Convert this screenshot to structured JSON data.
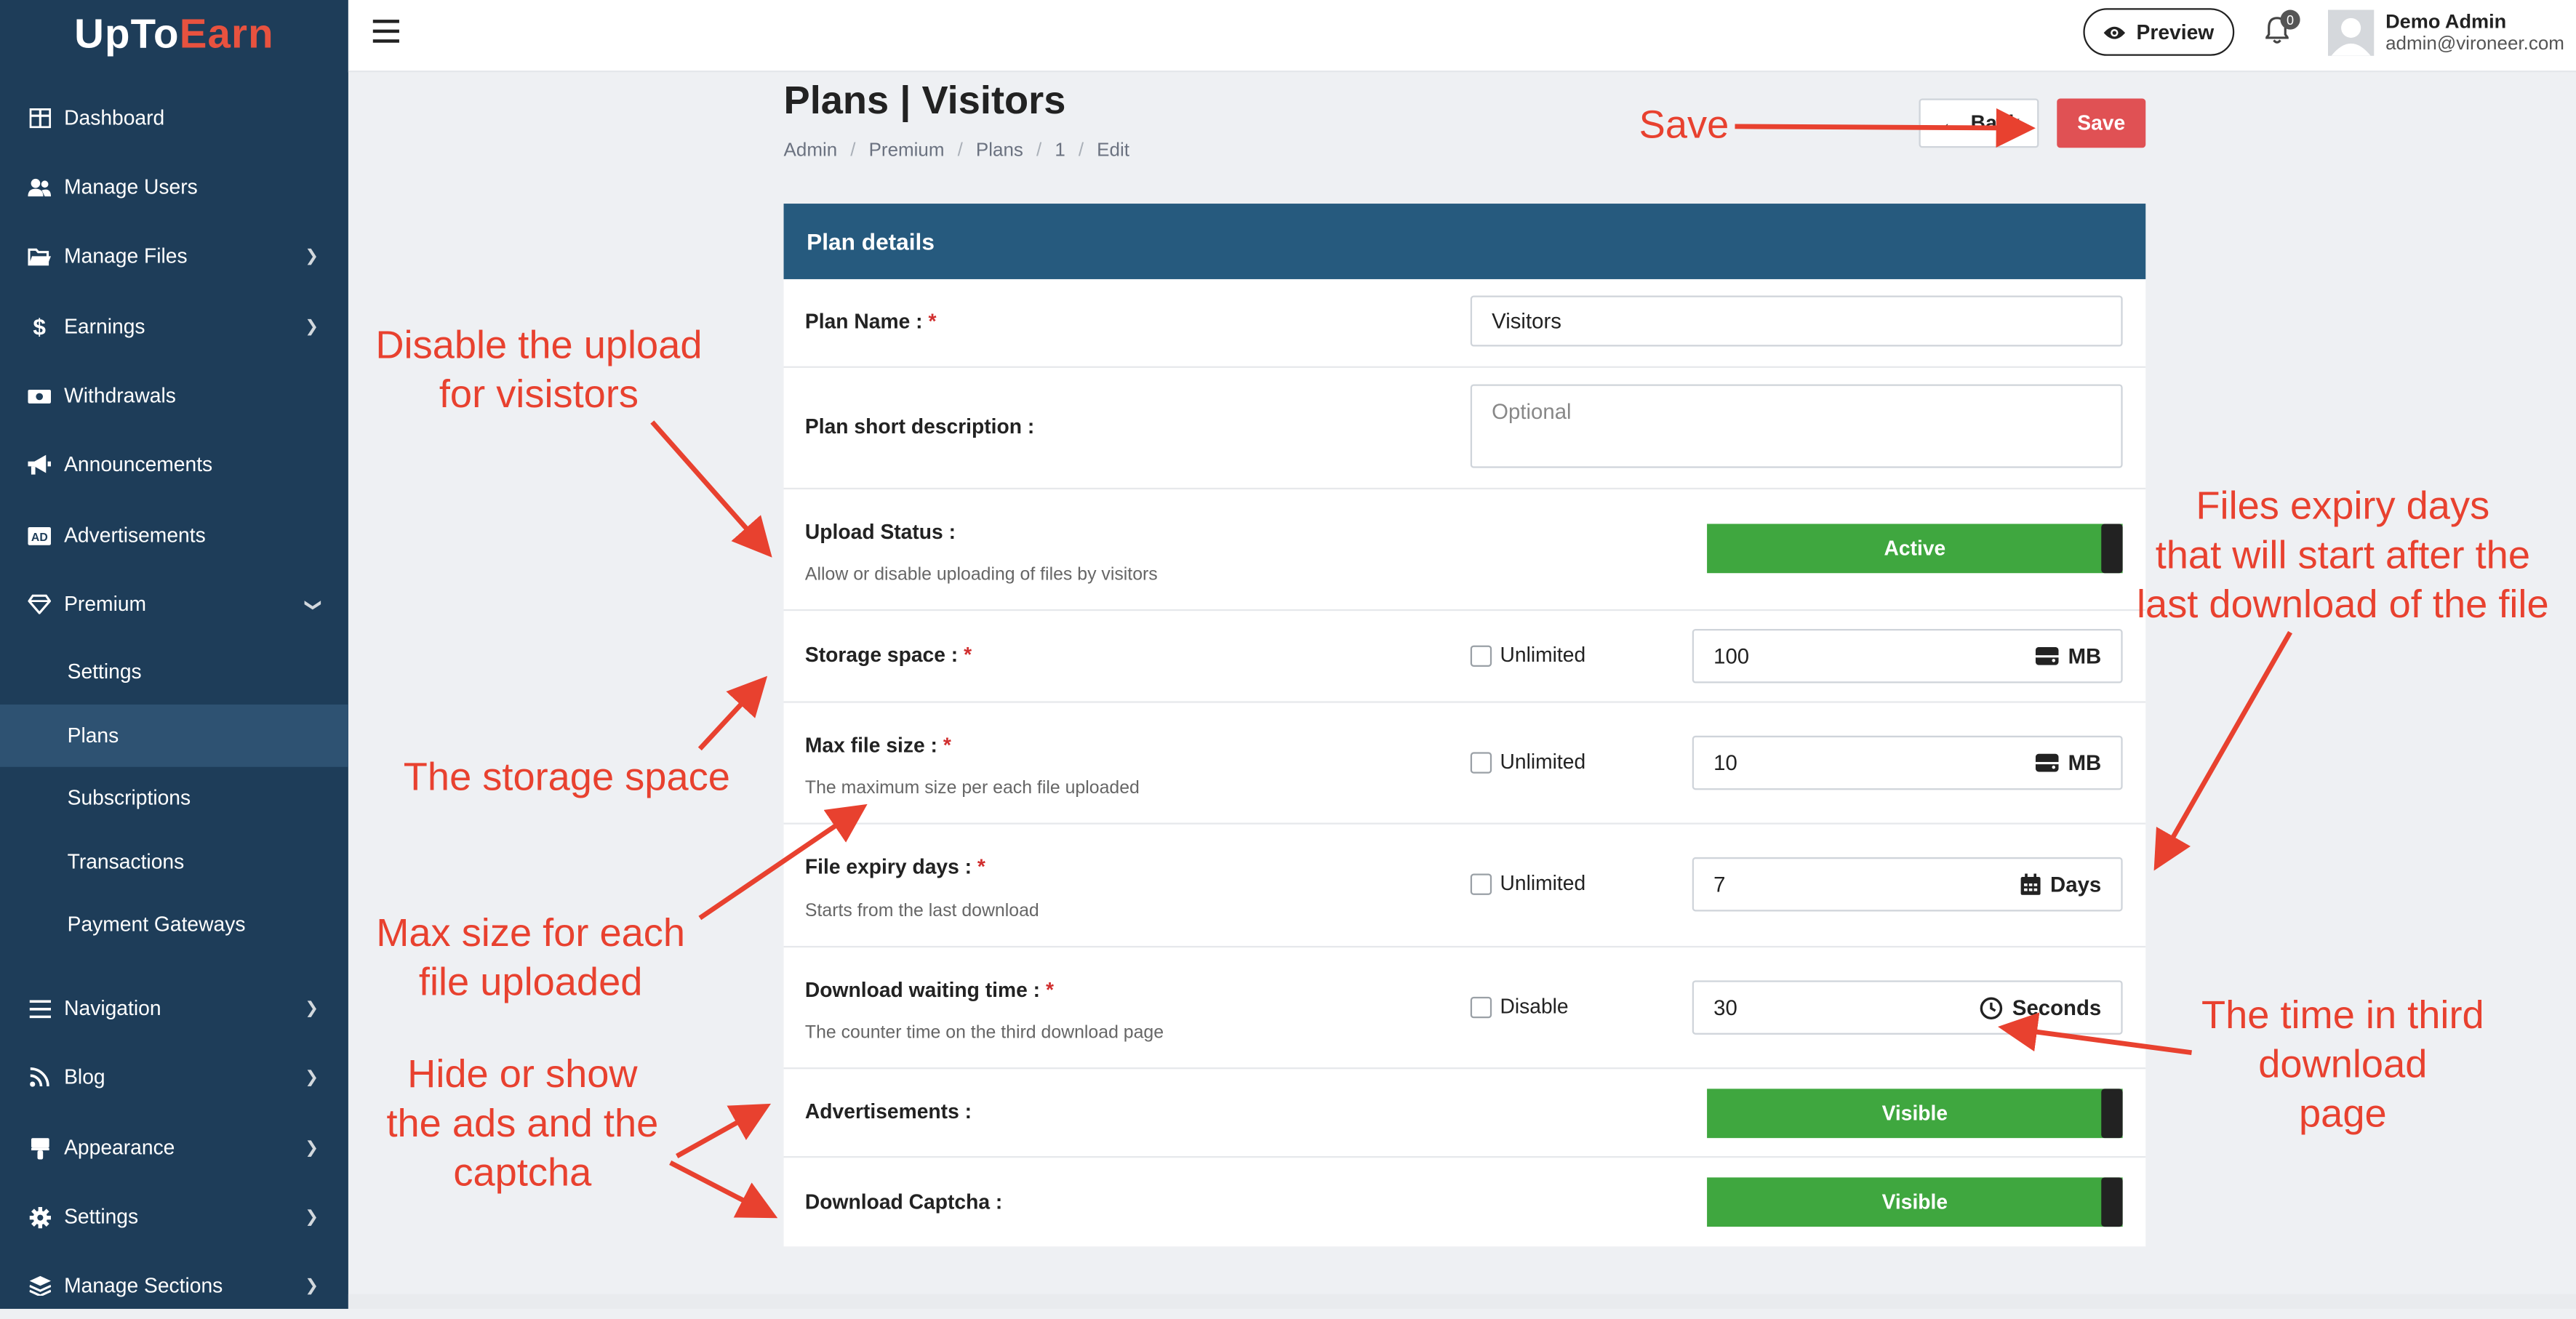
{
  "app": {
    "logo_part1": "UpTo",
    "logo_part2": "Earn"
  },
  "sidebar": {
    "items": [
      {
        "label": "Dashboard",
        "icon": "dashboard-icon"
      },
      {
        "label": "Manage Users",
        "icon": "users-icon"
      },
      {
        "label": "Manage Files",
        "icon": "folder-icon"
      },
      {
        "label": "Earnings",
        "icon": "dollar-icon"
      },
      {
        "label": "Withdrawals",
        "icon": "money-icon"
      },
      {
        "label": "Announcements",
        "icon": "megaphone-icon"
      },
      {
        "label": "Advertisements",
        "icon": "ad-icon"
      },
      {
        "label": "Premium",
        "icon": "gem-icon"
      },
      {
        "label": "Navigation",
        "icon": "list-icon"
      },
      {
        "label": "Blog",
        "icon": "rss-icon"
      },
      {
        "label": "Appearance",
        "icon": "brush-icon"
      },
      {
        "label": "Settings",
        "icon": "gear-icon"
      },
      {
        "label": "Manage Sections",
        "icon": "layers-icon"
      }
    ],
    "premium_sub": [
      "Settings",
      "Plans",
      "Subscriptions",
      "Transactions",
      "Payment Gateways"
    ]
  },
  "topbar": {
    "preview_label": "Preview",
    "notification_count": "0",
    "user_name": "Demo Admin",
    "user_email": "admin@vironeer.com"
  },
  "page": {
    "title": "Plans | Visitors",
    "breadcrumbs": [
      "Admin",
      "Premium",
      "Plans",
      "1",
      "Edit"
    ],
    "back_label": "Back",
    "save_label": "Save"
  },
  "form": {
    "header": "Plan details",
    "plan_name_label": "Plan Name :",
    "plan_name_value": "Visitors",
    "short_desc_label": "Plan short description :",
    "short_desc_placeholder": "Optional",
    "upload_status_label": "Upload Status :",
    "upload_status_hint": "Allow or disable uploading of files by visitors",
    "upload_status_value": "Active",
    "storage_label": "Storage space :",
    "storage_unlimited": "Unlimited",
    "storage_value": "100",
    "storage_unit": "MB",
    "max_size_label": "Max file size :",
    "max_size_hint": "The maximum size per each file uploaded",
    "max_size_unlimited": "Unlimited",
    "max_size_value": "10",
    "max_size_unit": "MB",
    "expiry_label": "File expiry days :",
    "expiry_hint": "Starts from the last download",
    "expiry_unlimited": "Unlimited",
    "expiry_value": "7",
    "expiry_unit": "Days",
    "wait_label": "Download waiting time :",
    "wait_hint": "The counter time on the third download page",
    "wait_disable": "Disable",
    "wait_value": "30",
    "wait_unit": "Seconds",
    "ads_label": "Advertisements :",
    "ads_value": "Visible",
    "captcha_label": "Download Captcha :",
    "captcha_value": "Visible",
    "required_mark": "*"
  },
  "annotations": {
    "save": "Save",
    "disable_upload": "Disable the upload\nfor visistors",
    "storage": "The storage space",
    "max_size": "Max size for each\nfile uploaded",
    "ads_captcha": "Hide or show\nthe ads and the\ncaptcha",
    "expiry": "Files expiry days\nthat will start after the\nlast download of the file",
    "wait": "The time in third\ndownload\npage"
  },
  "colors": {
    "sidebar_bg": "#1e3d59",
    "card_header": "#265a7e",
    "toggle_green": "#3fa73f",
    "save_red": "#e05154",
    "annotation_red": "#e8412f"
  }
}
